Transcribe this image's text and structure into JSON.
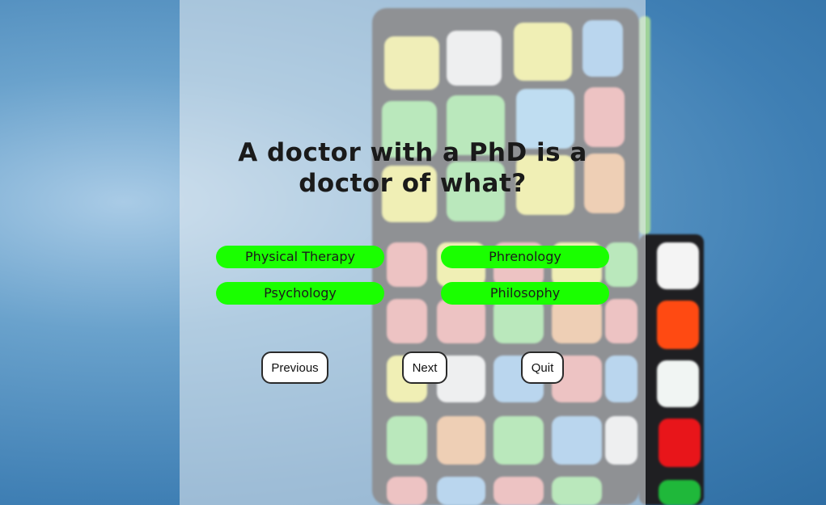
{
  "quiz": {
    "question": "A doctor with a PhD is a doctor of what?",
    "answers": [
      {
        "label": "Physical Therapy"
      },
      {
        "label": "Phrenology"
      },
      {
        "label": "Psychology"
      },
      {
        "label": "Philosophy"
      }
    ],
    "answer_color": "#1aff00"
  },
  "navigation": {
    "previous_label": "Previous",
    "next_label": "Next",
    "quit_label": "Quit"
  },
  "background": {
    "description_colors": [
      "#2f6ea3",
      "#a9cbe6"
    ]
  }
}
